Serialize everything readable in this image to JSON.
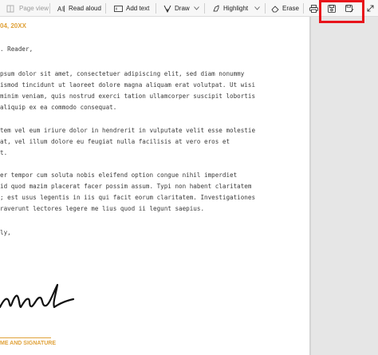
{
  "toolbar": {
    "page_view": "Page view",
    "read_aloud": "Read aloud",
    "add_text": "Add text",
    "draw": "Draw",
    "highlight": "Highlight",
    "erase": "Erase"
  },
  "document": {
    "date": "04, 20XX",
    "greeting": ". Reader,",
    "lines": [
      "psum dolor sit amet, consectetuer adipiscing elit, sed diam nonummy",
      "ismod tincidunt ut laoreet dolore magna aliquam erat volutpat. Ut wisi",
      " minim veniam, quis nostrud exerci tation ullamcorper suscipit lobortis",
      " aliquip ex ea commodo consequat.",
      "",
      "tem vel eum iriure dolor in hendrerit in vulputate velit esse molestie",
      "at, vel illum dolore eu feugiat nulla facilisis at vero eros et",
      "t.",
      "",
      "er tempor cum soluta nobis eleifend option congue nihil imperdiet",
      "id quod mazim placerat facer possim assum. Typi non habent claritatem",
      "; est usus legentis in iis qui facit eorum claritatem. Investigationes",
      " raverunt lectores legere me lius quod ii legunt saepius.",
      "",
      "ly,"
    ],
    "signature_label": "ME AND SIGNATURE"
  },
  "colors": {
    "accent": "#e0a23a",
    "highlight_box": "#e8141b"
  }
}
